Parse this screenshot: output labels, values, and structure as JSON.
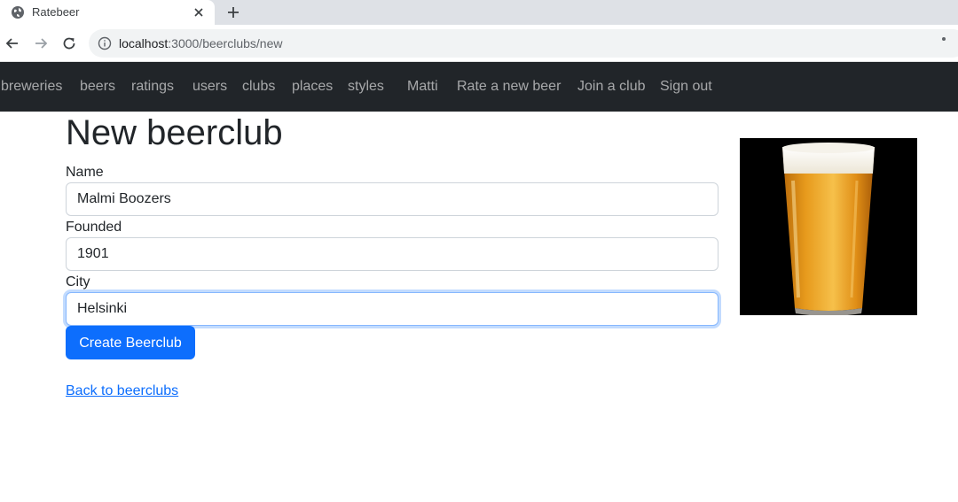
{
  "browser": {
    "tab_title": "Ratebeer",
    "url_host": "localhost",
    "url_rest": ":3000/beerclubs/new",
    "icons": [
      "globe-icon",
      "close-icon",
      "plus-icon",
      "back-arrow-icon",
      "forward-arrow-icon",
      "reload-icon",
      "info-icon"
    ]
  },
  "navbar": {
    "links": [
      "breweries",
      "beers",
      "ratings",
      "users",
      "clubs",
      "places",
      "styles",
      "Matti",
      "Rate a new beer",
      "Join a club",
      "Sign out"
    ]
  },
  "form": {
    "title": "New beerclub",
    "name_label": "Name",
    "name_value": "Malmi Boozers",
    "founded_label": "Founded",
    "founded_value": "1901",
    "city_label": "City",
    "city_value": "Helsinki",
    "submit_label": "Create Beerclub",
    "back_link": "Back to beerclubs"
  },
  "colors": {
    "navbar_bg": "#212529",
    "primary": "#0d6efd",
    "focus_border": "#86b7fe"
  }
}
